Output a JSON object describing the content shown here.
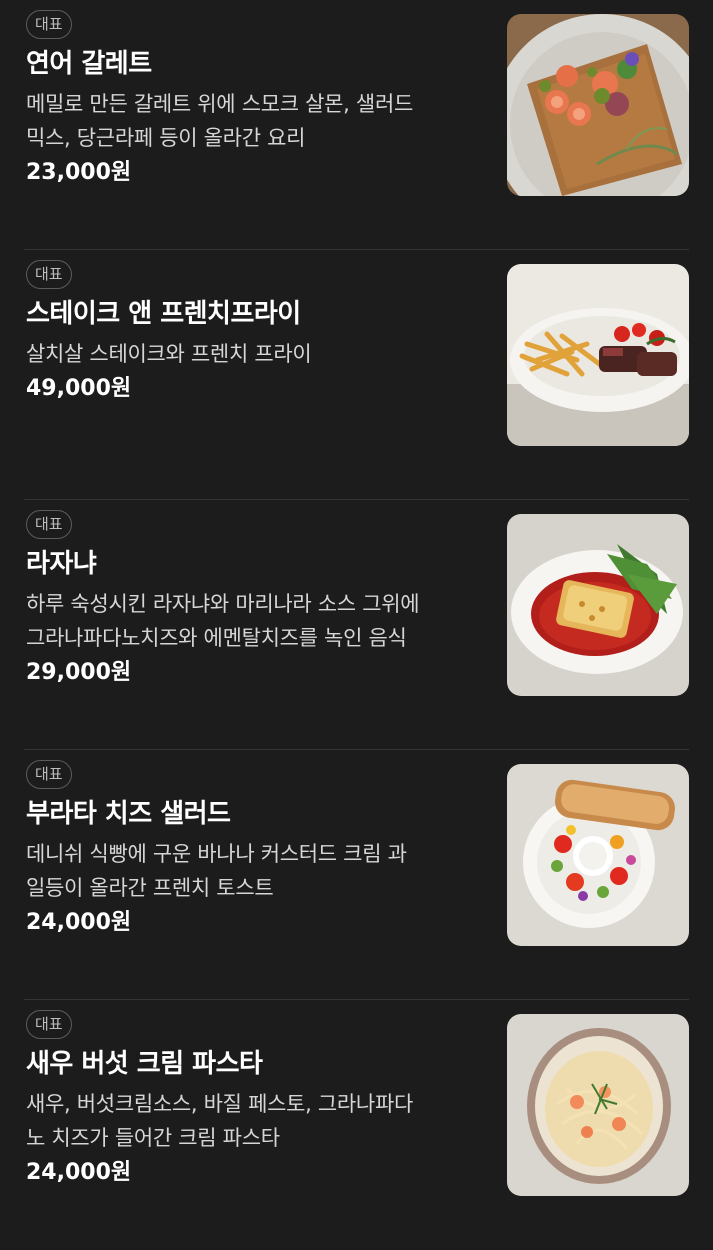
{
  "menu": {
    "items": [
      {
        "badge": "대표",
        "name": "연어 갈레트",
        "desc_lines": [
          "메밀로 만든 갈레트 위에 스모크 살몬, 샐러드",
          "믹스, 당근라페 등이 올라간 요리"
        ],
        "price": "23,000원",
        "image_icon": "galette-photo"
      },
      {
        "badge": "대표",
        "name": "스테이크 앤 프렌치프라이",
        "desc_lines": [
          "살치살 스테이크와 프렌치 프라이"
        ],
        "price": "49,000원",
        "image_icon": "steak-fries-photo"
      },
      {
        "badge": "대표",
        "name": "라자냐",
        "desc_lines": [
          "하루 숙성시킨 라자냐와 마리나라 소스 그위에",
          "그라나파다노치즈와 에멘탈치즈를 녹인 음식"
        ],
        "price": "29,000원",
        "image_icon": "lasagna-photo"
      },
      {
        "badge": "대표",
        "name": "부라타 치즈 샐러드",
        "desc_lines": [
          "데니쉬 식빵에 구운 바나나 커스터드 크림 과",
          "일등이 올라간 프렌치 토스트"
        ],
        "price": "24,000원",
        "image_icon": "burrata-salad-photo"
      },
      {
        "badge": "대표",
        "name": "새우 버섯 크림 파스타",
        "desc_lines": [
          "새우, 버섯크림소스, 바질 페스토, 그라나파다",
          "노 치즈가 들어간 크림 파스타"
        ],
        "price": "24,000원",
        "image_icon": "cream-pasta-photo"
      }
    ]
  },
  "colors": {
    "background": "#1c1c1c",
    "divider": "#343434",
    "badge_border": "#5b5b5b",
    "text_primary": "#ffffff",
    "text_secondary": "#d6d6d6"
  }
}
